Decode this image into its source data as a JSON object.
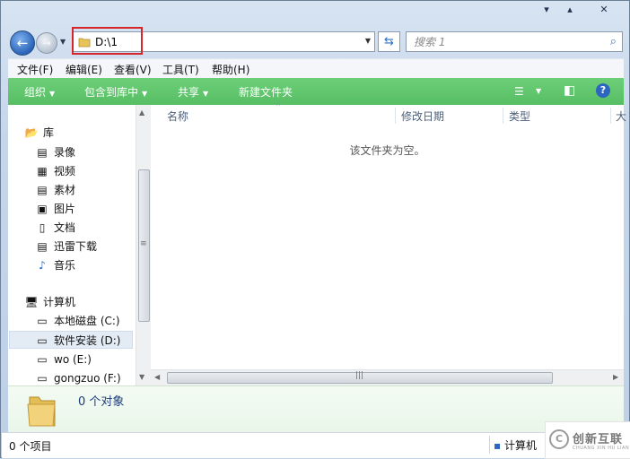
{
  "caption": {
    "minimize_glyph": "▾",
    "maximize_glyph": "▴",
    "close_glyph": "✕"
  },
  "nav": {
    "back_glyph": "←",
    "forward_glyph": "→",
    "recent_glyph": "▼"
  },
  "address": {
    "path": "D:\\1",
    "dropdown_glyph": "▼"
  },
  "refresh_glyph": "⇆",
  "search": {
    "placeholder": "搜索 1",
    "icon_glyph": "⌕"
  },
  "menubar": {
    "items": [
      {
        "label": "文件(F)"
      },
      {
        "label": "编辑(E)"
      },
      {
        "label": "查看(V)"
      },
      {
        "label": "工具(T)"
      },
      {
        "label": "帮助(H)"
      }
    ]
  },
  "toolbar": {
    "organize": "组织",
    "include_in_library": "包含到库中",
    "share": "共享",
    "new_folder": "新建文件夹",
    "caret": "▼",
    "view_glyph": "☰",
    "preview_glyph": "◧",
    "help_glyph": "?"
  },
  "sidebar": {
    "libraries": {
      "label": "库",
      "items": [
        {
          "label": "录像",
          "icon": "video-library-icon"
        },
        {
          "label": "视频",
          "icon": "film-icon"
        },
        {
          "label": "素材",
          "icon": "document-library-icon"
        },
        {
          "label": "图片",
          "icon": "picture-icon"
        },
        {
          "label": "文档",
          "icon": "document-icon"
        },
        {
          "label": "迅雷下载",
          "icon": "download-library-icon"
        },
        {
          "label": "音乐",
          "icon": "music-note-icon"
        }
      ]
    },
    "computer": {
      "label": "计算机",
      "items": [
        {
          "label": "本地磁盘 (C:)",
          "icon": "windows-drive-icon"
        },
        {
          "label": "软件安装 (D:)",
          "icon": "drive-icon",
          "selected": true
        },
        {
          "label": "wo (E:)",
          "icon": "drive-icon"
        },
        {
          "label": "gongzuo (F:)",
          "icon": "drive-icon"
        }
      ]
    }
  },
  "columns": {
    "name": "名称",
    "modified": "修改日期",
    "type": "类型",
    "size": "大"
  },
  "empty_message": "该文件夹为空。",
  "details": {
    "count": "0 个对象"
  },
  "status": {
    "items": "0 个项目",
    "location": "计算机"
  },
  "watermark": {
    "brand": "创新互联",
    "sub": "CHUANG XIN HU LIAN"
  },
  "colors": {
    "toolbar_green": "#5cc468",
    "highlight_red": "#d6262b",
    "accent_blue": "#2c66c0"
  }
}
